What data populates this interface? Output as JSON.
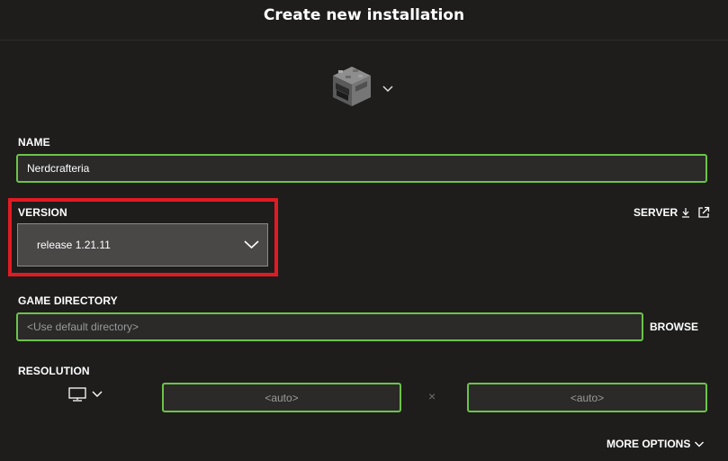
{
  "header": {
    "title": "Create new installation"
  },
  "icon_picker": {
    "icon": "furnace-block-icon",
    "chevron": "chevron-down-icon"
  },
  "name": {
    "label": "NAME",
    "value": "Nerdcrafteria"
  },
  "version": {
    "label": "VERSION",
    "selected": "release 1.21.11"
  },
  "server": {
    "label": "SERVER"
  },
  "game_directory": {
    "label": "GAME DIRECTORY",
    "placeholder": "<Use default directory>",
    "browse_label": "BROWSE"
  },
  "resolution": {
    "label": "RESOLUTION",
    "width_placeholder": "<auto>",
    "height_placeholder": "<auto>",
    "separator": "×"
  },
  "more_options": {
    "label": "MORE OPTIONS"
  },
  "colors": {
    "accent_green": "#6cc349",
    "highlight_red": "#e01b24",
    "background": "#1e1d1c"
  }
}
